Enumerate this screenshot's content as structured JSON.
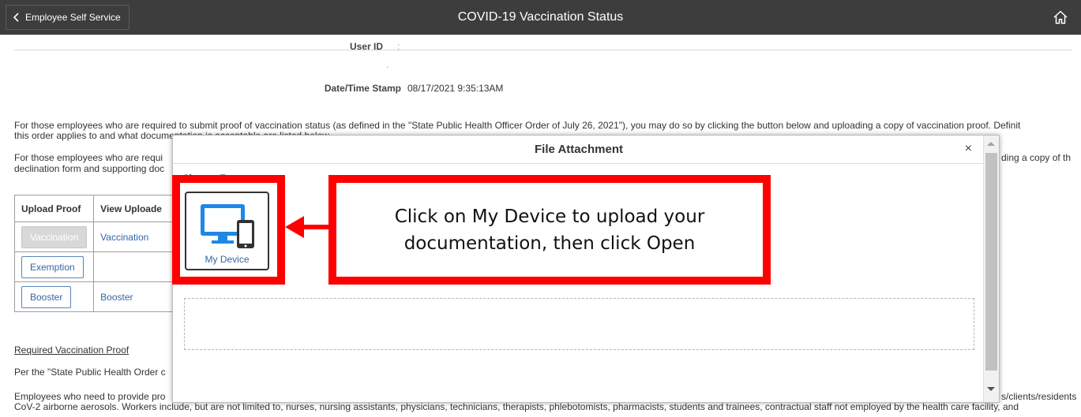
{
  "header": {
    "back_label": "Employee Self Service",
    "title": "COVID-19 Vaccination Status",
    "home_icon": "home-icon"
  },
  "fields": {
    "user_id_label": "User ID",
    "user_id_value": ":",
    "blank_value": ".",
    "timestamp_label": "Date/Time Stamp",
    "timestamp_value": "08/17/2021  9:35:13AM"
  },
  "paragraphs": {
    "p1_line1": "For those employees who are required to submit proof of vaccination status (as defined in the \"State Public Health Officer Order of July 26, 2021\"), you may do so by clicking the button below and uploading a copy of vaccination proof. Definit",
    "p1_line2": "this order applies to and what documentation is acceptable are listed below.",
    "p2_line1_left": "For those employees who are requi",
    "p2_line1_right": "ding a copy of th",
    "p2_line2": "declination form and supporting doc"
  },
  "table": {
    "headers": [
      "Upload Proof",
      "View Uploade"
    ],
    "rows": [
      {
        "button": "Vaccination",
        "link": "Vaccination",
        "disabled": true
      },
      {
        "button": "Exemption",
        "link": "",
        "disabled": false
      },
      {
        "button": "Booster",
        "link": "Booster",
        "disabled": false
      }
    ]
  },
  "lower": {
    "section_link": "Required Vaccination Proof",
    "per_line": "Per the \"State Public Health Order c",
    "employees_line_left": "Employees who need to provide pro",
    "employees_line_right": "s/clients/residents",
    "workers_line": "CoV-2 airborne aerosols. Workers include, but are not limited to, nurses, nursing assistants, physicians, technicians, therapists, phlebotomists, pharmacists, students and trainees, contractual staff not employed by the health care facility, and"
  },
  "modal": {
    "title": "File Attachment",
    "close_glyph": "×",
    "choose_from": "Choose From",
    "device_label": "My Device",
    "device_icon": "devices-icon"
  },
  "annotation": {
    "callout_line1": "Click on My Device to upload your",
    "callout_line2": "documentation, then click Open",
    "color": "#ff0000"
  }
}
